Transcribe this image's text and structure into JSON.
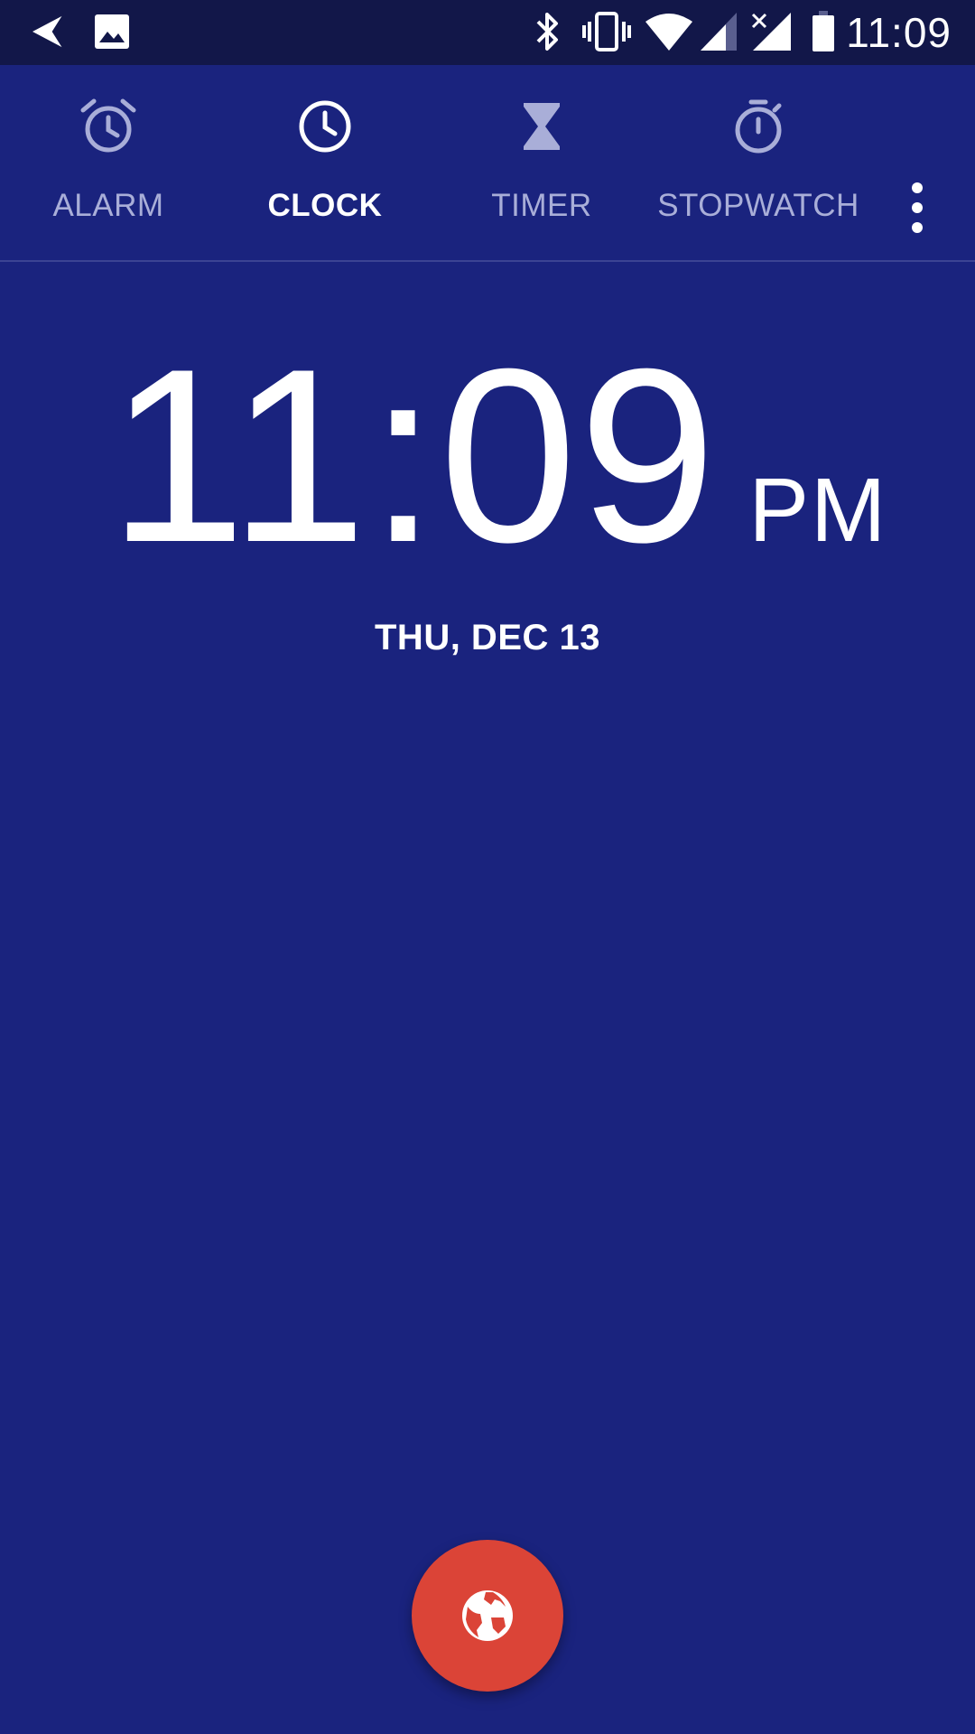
{
  "status_bar": {
    "time": "11:09",
    "left_icons": [
      "navigation-arrow-icon",
      "image-icon"
    ],
    "right_icons": [
      "bluetooth-icon",
      "vibrate-icon",
      "wifi-icon",
      "cell-signal-icon",
      "cell-signal-no-data-icon",
      "battery-icon"
    ]
  },
  "tabs": [
    {
      "label": "ALARM",
      "icon": "alarm-icon",
      "active": false
    },
    {
      "label": "CLOCK",
      "icon": "clock-icon",
      "active": true
    },
    {
      "label": "TIMER",
      "icon": "hourglass-icon",
      "active": false
    },
    {
      "label": "STOPWATCH",
      "icon": "stopwatch-icon",
      "active": false
    }
  ],
  "overflow_icon": "more-vert-icon",
  "clock": {
    "time": "11:09",
    "ampm": "PM",
    "date": "THU, DEC 13"
  },
  "fab": {
    "icon": "globe-icon"
  },
  "colors": {
    "background": "#1a237e",
    "status_bar": "#121749",
    "tab_inactive": "#a9aed8",
    "tab_active": "#ffffff",
    "fab": "#db4437"
  }
}
